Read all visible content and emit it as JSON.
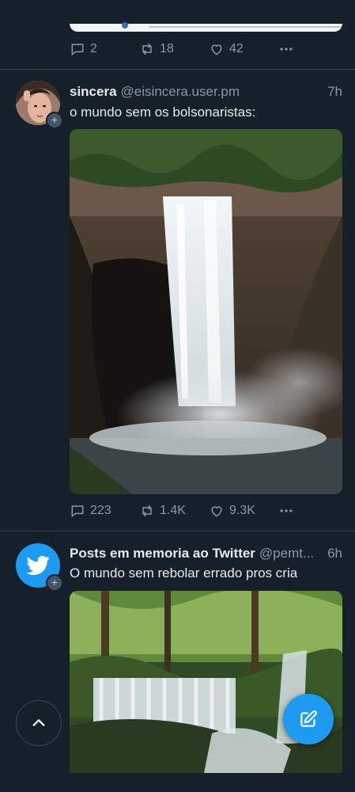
{
  "tweet_prev": {
    "replies": "2",
    "retweets": "18",
    "likes": "42"
  },
  "tweet1": {
    "name": "sincera",
    "handle": "@eisincera.user.pm",
    "time": "7h",
    "text": "o mundo sem os bolsonaristas:",
    "media_icon": "waterfall-image",
    "replies": "223",
    "retweets": "1.4K",
    "likes": "9.3K"
  },
  "tweet2": {
    "name": "Posts em memoria ao Twitter",
    "handle": "@pemt...",
    "time": "6h",
    "text": "O mundo sem rebolar errado pros cria",
    "avatar_icon": "twitter-bird-icon",
    "media_icon": "forest-waterfall-image"
  },
  "colors": {
    "background": "#15202b",
    "accent": "#1d9bf0",
    "muted": "#8b98a5"
  }
}
